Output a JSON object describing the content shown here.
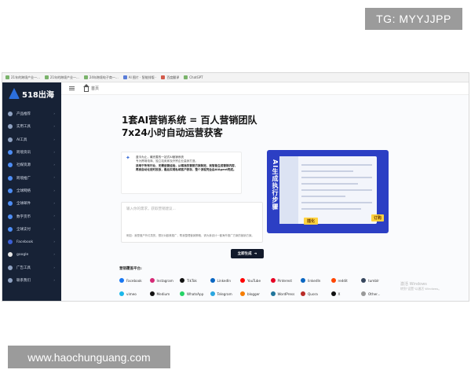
{
  "watermarks": {
    "top": "TG: MYYJJPP",
    "bottom": "www.haochunguang.com"
  },
  "bookmarks": [
    "21年的跨境产业一...",
    "21年的跨境产业一...",
    "24年跨境电子商一...",
    "AI 图片 · 智能排版 ·",
    "百度翻译",
    "ChatGPT"
  ],
  "sidebar": {
    "logo_text": "518出海",
    "items": [
      {
        "label": "产品推荐",
        "icon": "box-icon",
        "color": "#8fa2c2"
      },
      {
        "label": "实用工具",
        "icon": "tools-icon",
        "color": "#8fa2c2"
      },
      {
        "label": "AI工具",
        "icon": "ai-icon",
        "color": "#8fa2c2"
      },
      {
        "label": "跨境资讯",
        "icon": "globe-icon",
        "color": "#4d8df5"
      },
      {
        "label": "社媒资源",
        "icon": "social-icon",
        "color": "#4d8df5"
      },
      {
        "label": "跨境推广",
        "icon": "megaphone-icon",
        "color": "#4d8df5"
      },
      {
        "label": "全球网络",
        "icon": "network-icon",
        "color": "#4d8df5"
      },
      {
        "label": "全球邮件",
        "icon": "mail-icon",
        "color": "#4d8df5"
      },
      {
        "label": "数字货币",
        "icon": "coin-icon",
        "color": "#4d8df5"
      },
      {
        "label": "全球支付",
        "icon": "payment-icon",
        "color": "#4d8df5"
      },
      {
        "label": "Facebook",
        "icon": "facebook-icon",
        "color": "#3b5fd6"
      },
      {
        "label": "google",
        "icon": "google-icon",
        "color": "#e5e5e5"
      },
      {
        "label": "广告工具",
        "icon": "ad-icon",
        "color": "#8fa2c2"
      },
      {
        "label": "联系我们",
        "icon": "contact-icon",
        "color": "#8fa2c2"
      }
    ]
  },
  "topbar": {
    "home_label": "首页"
  },
  "headline": {
    "line1": "1套AI营销系统 = 百人营销团队",
    "line2": "7x24小时自动运营获客"
  },
  "intro": {
    "line1": "蓝今为止，最完善的一站式AI营销系统",
    "line2": "专为跨境电商、独立站卖家及外贸企业量身打造。",
    "line3": "适用于所有行业、无需运营经验，从精准的营销方案制定，到智能生成营销内容，再到自动化定时投放，最后实现私域客户获存，整个流程完全由AIAgent完成。"
  },
  "promo": {
    "vertical_text": "AI生成执行步骤",
    "tag": "插化",
    "tag2": "订购"
  },
  "input": {
    "placeholder": "输入你的需求，获取营销建议...",
    "hint": "例如：我是做户外灯具的，想针对欧美推广，帮我整理营销策略，请为我设计一套海外推广方案的营销方案。"
  },
  "generate_button": {
    "label": "立即生成",
    "icon": "arrow-icon"
  },
  "channels": {
    "title": "营销覆盖平台:",
    "row1": [
      {
        "label": "Facebook",
        "color": "#1877f2"
      },
      {
        "label": "Instagram",
        "color": "#d62976"
      },
      {
        "label": "TikTok",
        "color": "#111111"
      },
      {
        "label": "LinkedIn",
        "color": "#0a66c2"
      },
      {
        "label": "YouTube",
        "color": "#ff0000"
      },
      {
        "label": "Pinterest",
        "color": "#e60023"
      },
      {
        "label": "linkedIn",
        "color": "#0a66c2"
      },
      {
        "label": "reddit",
        "color": "#ff4500"
      },
      {
        "label": "tumblr",
        "color": "#36465d"
      }
    ],
    "row2": [
      {
        "label": "vimeo",
        "color": "#1ab7ea"
      },
      {
        "label": "Medium",
        "color": "#111111"
      },
      {
        "label": "WhatsApp",
        "color": "#25d366"
      },
      {
        "label": "Telegram",
        "color": "#2aa6df"
      },
      {
        "label": "blogger",
        "color": "#f57d00"
      },
      {
        "label": "WordPress",
        "color": "#21759b"
      },
      {
        "label": "Quora",
        "color": "#b92b27"
      },
      {
        "label": "X",
        "color": "#111111"
      },
      {
        "label": "Other...",
        "color": "#999999"
      }
    ]
  },
  "windows_watermark": {
    "title": "激活 Windows",
    "subtitle": "转到\"设置\"以激活 Windows。"
  }
}
